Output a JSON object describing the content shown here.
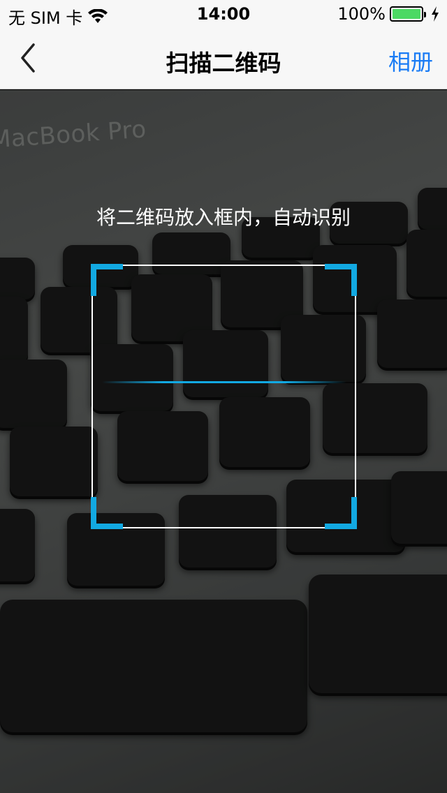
{
  "status_bar": {
    "carrier": "无 SIM 卡",
    "wifi_icon": "wifi-icon",
    "time": "14:00",
    "battery_percent": "100%",
    "battery_level": 1.0,
    "charging_icon": "charging-bolt-icon",
    "battery_color": "#4cd964"
  },
  "nav": {
    "back_icon": "chevron-left-icon",
    "title": "扫描二维码",
    "album_label": "相册",
    "accent": "#1a7cf5"
  },
  "scanner": {
    "hint": "将二维码放入框内，自动识别",
    "corner_color": "#12a9e2",
    "frame_color": "#ffffff"
  }
}
